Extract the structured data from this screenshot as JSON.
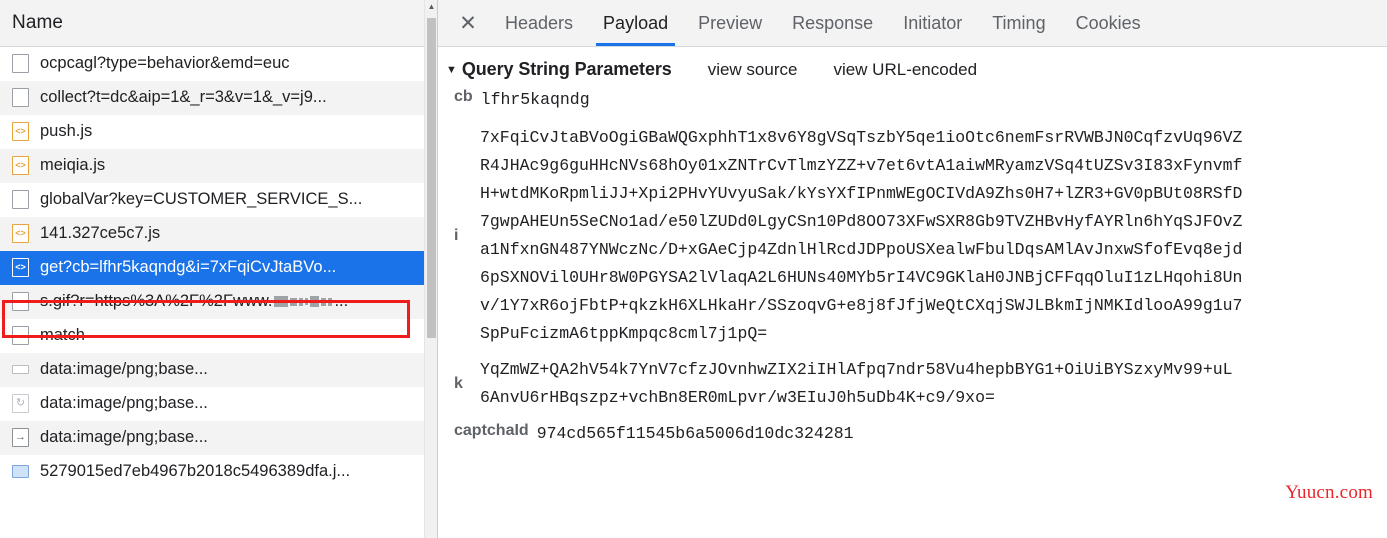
{
  "network_panel": {
    "column_header": "Name",
    "rows": [
      {
        "icon": "document-icon",
        "icon_kind": "doc",
        "label": "ocpcagl?type=behavior&emd=euc"
      },
      {
        "icon": "document-icon",
        "icon_kind": "doc",
        "label": "collect?t=dc&aip=1&_r=3&v=1&_v=j9..."
      },
      {
        "icon": "javascript-icon",
        "icon_kind": "js",
        "label": "push.js"
      },
      {
        "icon": "javascript-icon",
        "icon_kind": "js",
        "label": "meiqia.js"
      },
      {
        "icon": "document-icon",
        "icon_kind": "doc",
        "label": "globalVar?key=CUSTOMER_SERVICE_S..."
      },
      {
        "icon": "javascript-icon",
        "icon_kind": "js",
        "label": "141.327ce5c7.js"
      },
      {
        "icon": "javascript-icon",
        "icon_kind": "js",
        "label": "get?cb=lfhr5kaqndg&i=7xFqiCvJtaBVo...",
        "selected": true
      },
      {
        "icon": "document-icon",
        "icon_kind": "doc",
        "label": "s.gif?r=https%3A%2F%2Fwww.",
        "redacted": true,
        "label_suffix": "..."
      },
      {
        "icon": "document-icon",
        "icon_kind": "doc",
        "label": "match"
      },
      {
        "icon": "placeholder-icon",
        "icon_kind": "dash",
        "label": "data:image/png;base..."
      },
      {
        "icon": "pending-icon",
        "icon_kind": "spin",
        "label": "data:image/png;base..."
      },
      {
        "icon": "redirect-icon",
        "icon_kind": "arrow",
        "label": "data:image/png;base..."
      },
      {
        "icon": "image-icon",
        "icon_kind": "img",
        "label": "5279015ed7eb4967b2018c5496389dfa.j..."
      }
    ],
    "scrollbar": {
      "up_arrow": "▲"
    },
    "highlight_color": "#f01b1b",
    "selected_row_color": "#1a73e8"
  },
  "detail_panel": {
    "close_label": "✕",
    "tabs": [
      {
        "label": "Headers",
        "active": false
      },
      {
        "label": "Payload",
        "active": true
      },
      {
        "label": "Preview",
        "active": false
      },
      {
        "label": "Response",
        "active": false
      },
      {
        "label": "Initiator",
        "active": false
      },
      {
        "label": "Timing",
        "active": false
      },
      {
        "label": "Cookies",
        "active": false
      }
    ],
    "section": {
      "caret": "▼",
      "title": "Query String Parameters",
      "view_source_label": "view source",
      "view_url_encoded_label": "view URL-encoded"
    },
    "parameters": [
      {
        "key": "cb",
        "type": "single",
        "value": "lfhr5kaqndg"
      },
      {
        "key": "i",
        "type": "multiline",
        "lines": [
          "7xFqiCvJtaBVoOgiGBaWQGxphhT1x8v6Y8gVSqTszbY5qe1ioOtc6nemFsrRVWBJN0CqfzvUq96VZ",
          "R4JHAc9g6guHHcNVs68hOy01xZNTrCvTlmzYZZ+v7et6vtA1aiwMRyamzVSq4tUZSv3I83xFynvmf",
          "H+wtdMKoRpmliJJ+Xpi2PHvYUvyuSak/kYsYXfIPnmWEgOCIVdA9Zhs0H7+lZR3+GV0pBUt08RSfD",
          "7gwpAHEUn5SeCNo1ad/e50lZUDd0LgyCSn10Pd8OO73XFwSXR8Gb9TVZHBvHyfAYRln6hYqSJFOvZ",
          "a1NfxnGN487YNWczNc/D+xGAeCjp4ZdnlHlRcdJDPpoUSXealwFbulDqsAMlAvJnxwSfofEvq8ejd",
          "6pSXNOVil0UHr8W0PGYSA2lVlaqA2L6HUNs40MYb5rI4VC9GKlaH0JNBjCFFqqOluI1zLHqohi8Un",
          "v/1Y7xR6ojFbtP+qkzkH6XLHkaHr/SSzoqvG+e8j8fJfjWeQtCXqjSWJLBkmIjNMKIdlooA99g1u7",
          "SpPuFcizmA6tppKmpqc8cml7j1pQ="
        ]
      },
      {
        "key": "k",
        "type": "multiline",
        "lines": [
          "YqZmWZ+QA2hV54k7YnV7cfzJOvnhwZIX2iIHlAfpq7ndr58Vu4hepbBYG1+OiUiBYSzxyMv99+uL",
          "6AnvU6rHBqszpz+vchBn8ER0mLpvr/w3EIuJ0h5uDb4K+c9/9xo="
        ]
      },
      {
        "key": "captchaId",
        "type": "single",
        "value": "974cd565f11545b6a5006d10dc324281"
      }
    ]
  },
  "watermark": {
    "text": "Yuucn.com",
    "color": "#e8262b"
  }
}
